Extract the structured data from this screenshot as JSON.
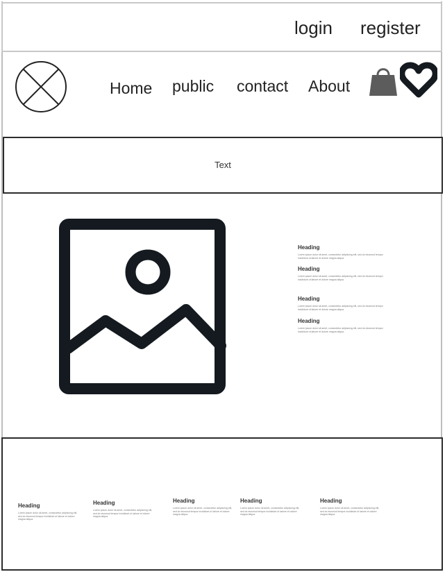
{
  "header": {
    "login_label": "login",
    "register_label": "register"
  },
  "nav": {
    "logo_icon": "circle-x-placeholder-icon",
    "items": [
      {
        "label": "Home"
      },
      {
        "label": "public"
      },
      {
        "label": "contact"
      },
      {
        "label": "About"
      }
    ],
    "cart_icon": "shopping-bag-icon",
    "wishlist_icon": "heart-icon"
  },
  "banner": {
    "text": "Text"
  },
  "hero": {
    "image_icon": "image-placeholder-icon",
    "side_items": [
      {
        "heading": "Heading",
        "body": "Lorem ipsum dolor sit amet, consectetur adipiscing elit, sed do eiusmod tempor incididunt ut labore et dolore magna aliqua."
      },
      {
        "heading": "Heading",
        "body": "Lorem ipsum dolor sit amet, consectetur adipiscing elit, sed do eiusmod tempor incididunt ut labore et dolore magna aliqua."
      },
      {
        "heading": "Heading",
        "body": "Lorem ipsum dolor sit amet, consectetur adipiscing elit, sed do eiusmod tempor incididunt ut labore et dolore magna aliqua."
      },
      {
        "heading": "Heading",
        "body": "Lorem ipsum dolor sit amet, consectetur adipiscing elit, sed do eiusmod tempor incididunt ut labore et dolore magna aliqua."
      }
    ]
  },
  "footer": {
    "columns": [
      {
        "heading": "Heading",
        "body": "Lorem ipsum dolor sit amet, consectetur adipiscing elit, sed do eiusmod tempor incididunt ut labore et dolore magna aliqua."
      },
      {
        "heading": "Heading",
        "body": "Lorem ipsum dolor sit amet, consectetur adipiscing elit, sed do eiusmod tempor incididunt ut labore et dolore magna aliqua."
      },
      {
        "heading": "Heading",
        "body": "Lorem ipsum dolor sit amet, consectetur adipiscing elit, sed do eiusmod tempor incididunt ut labore et dolore magna aliqua."
      },
      {
        "heading": "Heading",
        "body": "Lorem ipsum dolor sit amet, consectetur adipiscing elit, sed do eiusmod tempor incididunt ut labore et dolore magna aliqua."
      },
      {
        "heading": "Heading",
        "body": "Lorem ipsum dolor sit amet, consectetur adipiscing elit, sed do eiusmod tempor incididunt ut labore et dolore magna aliqua."
      }
    ]
  },
  "colors": {
    "icon_dark": "#141a1f",
    "bag_gray": "#5c5c5c",
    "border_dark": "#2b2b2b",
    "border_light": "#c8c8c8"
  }
}
